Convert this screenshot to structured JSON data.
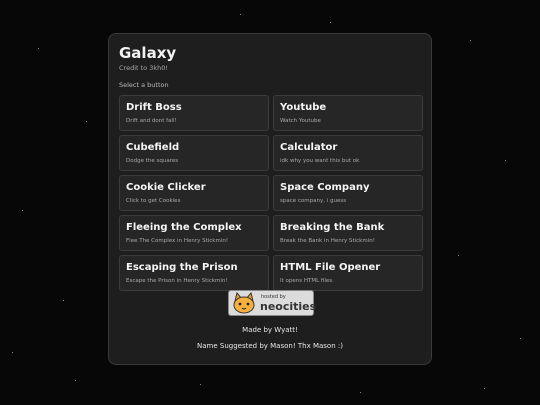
{
  "header": {
    "title": "Galaxy",
    "credit": "Credit to 3kh0!",
    "prompt": "Select a button"
  },
  "buttons": [
    {
      "title": "Drift Boss",
      "desc": "Drift and dont fall!"
    },
    {
      "title": "Youtube",
      "desc": "Watch Youtube"
    },
    {
      "title": "Cubefield",
      "desc": "Dodge the squares"
    },
    {
      "title": "Calculator",
      "desc": "idk why you want this but ok"
    },
    {
      "title": "Cookie Clicker",
      "desc": "Click to get Cookies"
    },
    {
      "title": "Space Company",
      "desc": "space company, i guess"
    },
    {
      "title": "Fleeing the Complex",
      "desc": "Flee The Complex in Henry Stickmin!"
    },
    {
      "title": "Breaking the Bank",
      "desc": "Break the Bank in Henry Stickmin!"
    },
    {
      "title": "Escaping the Prison",
      "desc": "Escape the Prison in Henry Stickmin!"
    },
    {
      "title": "HTML File Opener",
      "desc": "It opens HTML files."
    }
  ],
  "badge": {
    "small": "hosted by",
    "big": "neocities",
    "icon": "neocities-cat-icon"
  },
  "footer": {
    "made_by": "Made by Wyatt!",
    "name_suggested": "Name Suggested by Mason! Thx Mason :)"
  },
  "colors": {
    "background": "#070707",
    "panel": "#1e1e1e",
    "button": "#262626",
    "border": "#3c3c3c"
  }
}
